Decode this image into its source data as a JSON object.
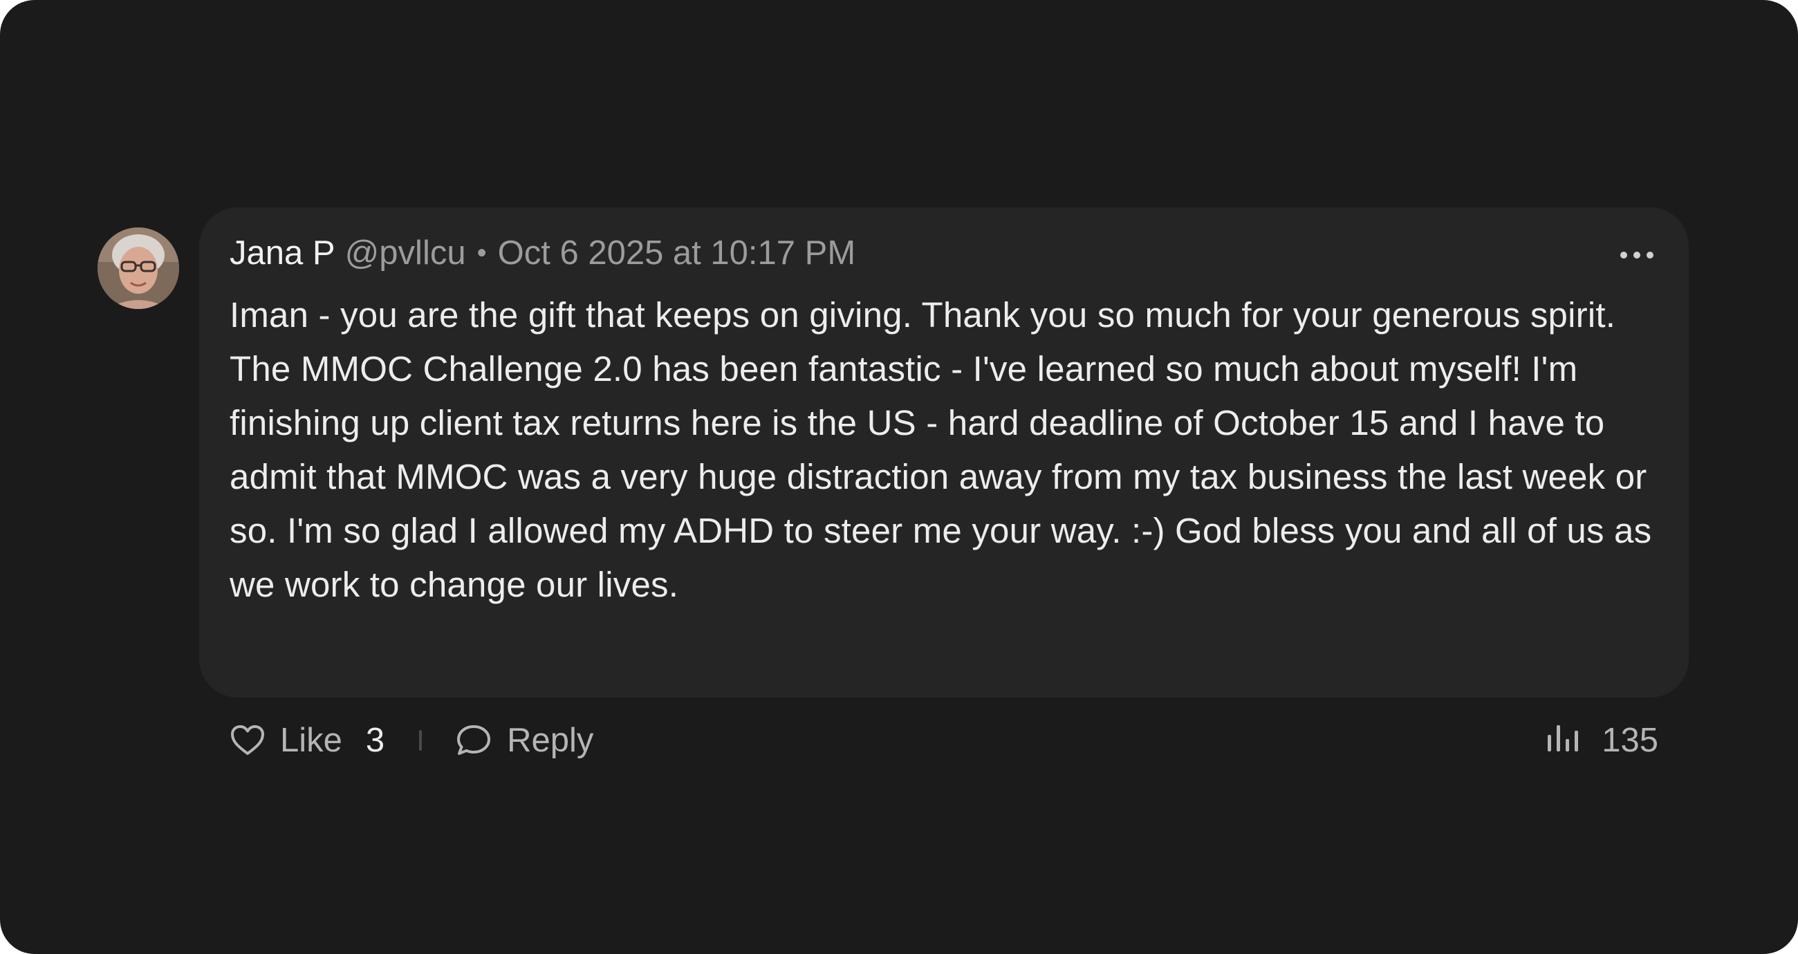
{
  "comment": {
    "author": "Jana P",
    "handle": "@pvllcu",
    "separator": "•",
    "timestamp": "Oct 6 2025 at 10:17 PM",
    "text": "Iman - you are the gift that keeps on giving. Thank you so much for your generous spirit. The MMOC Challenge 2.0 has been fantastic - I've learned so much about myself! I'm finishing up client tax returns here is the US - hard deadline of October 15 and I have to admit that MMOC was a very huge distraction away from my tax business the last week or so. I'm so glad I allowed my ADHD to steer me your way. :-) God bless you and all of us as we work to change our lives."
  },
  "actions": {
    "like_label": "Like",
    "like_count": "3",
    "reply_label": "Reply",
    "views_count": "135"
  },
  "icons": {
    "avatar": "user-avatar",
    "more": "more-horizontal-icon",
    "like": "heart-icon",
    "reply": "comment-bubble-icon",
    "views": "bar-chart-icon"
  },
  "colors": {
    "page_background": "#1b1b1b",
    "bubble_background": "#252525",
    "primary_text": "#ededed",
    "secondary_text": "#9c9c9c"
  }
}
